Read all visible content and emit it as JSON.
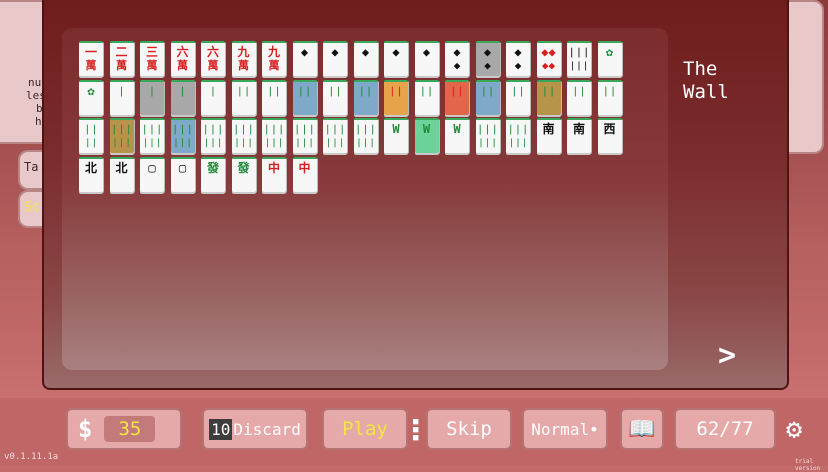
{
  "side_panel": {
    "lines": [
      "nu",
      "les",
      "b",
      "h"
    ],
    "tab_label": "Ta",
    "score_label": "Sc"
  },
  "wall": {
    "title": "The\nWall",
    "tiles": [
      {
        "glyph": "一",
        "sub": "萬",
        "color": "red",
        "hl": ""
      },
      {
        "glyph": "二",
        "sub": "萬",
        "color": "red",
        "hl": ""
      },
      {
        "glyph": "三",
        "sub": "萬",
        "color": "red",
        "hl": ""
      },
      {
        "glyph": "六",
        "sub": "萬",
        "color": "red",
        "hl": ""
      },
      {
        "glyph": "六",
        "sub": "萬",
        "color": "red",
        "hl": ""
      },
      {
        "glyph": "九",
        "sub": "萬",
        "color": "red",
        "hl": ""
      },
      {
        "glyph": "九",
        "sub": "萬",
        "color": "red",
        "hl": ""
      },
      {
        "glyph": "◆",
        "sub": "",
        "color": "black",
        "hl": ""
      },
      {
        "glyph": "◆",
        "sub": "",
        "color": "black",
        "hl": ""
      },
      {
        "glyph": "◆",
        "sub": "",
        "color": "black",
        "hl": ""
      },
      {
        "glyph": "◆",
        "sub": "",
        "color": "black",
        "hl": ""
      },
      {
        "glyph": "◆",
        "sub": "",
        "color": "black",
        "hl": ""
      },
      {
        "glyph": "◆",
        "sub": "◆",
        "color": "black",
        "hl": ""
      },
      {
        "glyph": "◆",
        "sub": "◆",
        "color": "black",
        "hl": "grey"
      },
      {
        "glyph": "◆",
        "sub": "◆",
        "color": "black",
        "hl": ""
      },
      {
        "glyph": "◆◆",
        "sub": "◆◆",
        "color": "red",
        "hl": ""
      },
      {
        "glyph": "❘❘❘",
        "sub": "❘❘❘",
        "color": "black",
        "hl": ""
      },
      {
        "glyph": "✿",
        "sub": "",
        "color": "green",
        "hl": ""
      },
      {
        "glyph": "✿",
        "sub": "",
        "color": "green",
        "hl": ""
      },
      {
        "glyph": "❘",
        "sub": "",
        "color": "green",
        "hl": ""
      },
      {
        "glyph": "❘",
        "sub": "",
        "color": "green",
        "hl": "grey"
      },
      {
        "glyph": "❘",
        "sub": "",
        "color": "green",
        "hl": "grey"
      },
      {
        "glyph": "❘",
        "sub": "",
        "color": "green",
        "hl": ""
      },
      {
        "glyph": "❘❘",
        "sub": "",
        "color": "green",
        "hl": ""
      },
      {
        "glyph": "❘❘",
        "sub": "",
        "color": "green",
        "hl": ""
      },
      {
        "glyph": "❘❘",
        "sub": "",
        "color": "green",
        "hl": "blue"
      },
      {
        "glyph": "❘❘",
        "sub": "",
        "color": "green",
        "hl": ""
      },
      {
        "glyph": "❘❘",
        "sub": "",
        "color": "green",
        "hl": "blue"
      },
      {
        "glyph": "❘❘",
        "sub": "",
        "color": "red",
        "hl": "orange"
      },
      {
        "glyph": "❘❘",
        "sub": "",
        "color": "green",
        "hl": ""
      },
      {
        "glyph": "❘❘",
        "sub": "",
        "color": "red",
        "hl": "red"
      },
      {
        "glyph": "❘❘",
        "sub": "",
        "color": "green",
        "hl": "blue"
      },
      {
        "glyph": "❘❘",
        "sub": "",
        "color": "green",
        "hl": ""
      },
      {
        "glyph": "❘❘",
        "sub": "",
        "color": "green",
        "hl": "olive"
      },
      {
        "glyph": "❘❘",
        "sub": "",
        "color": "green",
        "hl": ""
      },
      {
        "glyph": "❘❘",
        "sub": "",
        "color": "green",
        "hl": ""
      },
      {
        "glyph": "❘❘",
        "sub": "❘❘",
        "color": "green",
        "hl": ""
      },
      {
        "glyph": "❘❘❘",
        "sub": "❘❘❘",
        "color": "green",
        "hl": "olive"
      },
      {
        "glyph": "❘❘❘",
        "sub": "❘❘❘",
        "color": "green",
        "hl": ""
      },
      {
        "glyph": "❘❘❘",
        "sub": "❘❘❘",
        "color": "green",
        "hl": "blue"
      },
      {
        "glyph": "❘❘❘",
        "sub": "❘❘❘",
        "color": "green",
        "hl": ""
      },
      {
        "glyph": "❘❘❘",
        "sub": "❘❘❘",
        "color": "green",
        "hl": ""
      },
      {
        "glyph": "❘❘❘",
        "sub": "❘❘❘",
        "color": "green",
        "hl": ""
      },
      {
        "glyph": "❘❘❘",
        "sub": "❘❘❘",
        "color": "green",
        "hl": ""
      },
      {
        "glyph": "❘❘❘",
        "sub": "❘❘❘",
        "color": "green",
        "hl": ""
      },
      {
        "glyph": "❘❘❘",
        "sub": "❘❘❘",
        "color": "green",
        "hl": ""
      },
      {
        "glyph": "W",
        "sub": "",
        "color": "green",
        "hl": ""
      },
      {
        "glyph": "W",
        "sub": "",
        "color": "green",
        "hl": "green"
      },
      {
        "glyph": "W",
        "sub": "",
        "color": "green",
        "hl": ""
      },
      {
        "glyph": "❘❘❘",
        "sub": "❘❘❘",
        "color": "green",
        "hl": ""
      },
      {
        "glyph": "❘❘❘",
        "sub": "❘❘❘",
        "color": "green",
        "hl": ""
      },
      {
        "glyph": "南",
        "sub": "",
        "color": "black",
        "hl": ""
      },
      {
        "glyph": "南",
        "sub": "",
        "color": "black",
        "hl": ""
      },
      {
        "glyph": "西",
        "sub": "",
        "color": "black",
        "hl": ""
      },
      {
        "glyph": "北",
        "sub": "",
        "color": "black",
        "hl": ""
      },
      {
        "glyph": "北",
        "sub": "",
        "color": "black",
        "hl": ""
      },
      {
        "glyph": "▢",
        "sub": "",
        "color": "black",
        "hl": ""
      },
      {
        "glyph": "▢",
        "sub": "",
        "color": "black",
        "hl": ""
      },
      {
        "glyph": "發",
        "sub": "",
        "color": "green",
        "hl": ""
      },
      {
        "glyph": "發",
        "sub": "",
        "color": "green",
        "hl": ""
      },
      {
        "glyph": "中",
        "sub": "",
        "color": "red",
        "hl": ""
      },
      {
        "glyph": "中",
        "sub": "",
        "color": "red",
        "hl": ""
      }
    ],
    "next_label": ">"
  },
  "toolbar": {
    "money_symbol": "$",
    "money_value": "35",
    "discard_count": "10",
    "discard_label": "Discard",
    "play_label": "Play",
    "more_dots": "⋮",
    "skip_label": "Skip",
    "mode_label": "Normal•",
    "book_icon": "📖",
    "tile_count": "62/77",
    "gear_icon": "⚙"
  },
  "footer": {
    "version": "v0.1.11.1a",
    "trial": "trial version"
  },
  "colors": {
    "background": "#c46a6a",
    "modal": "#7a2c2c",
    "accent_yellow": "#f6e640",
    "tile_green_top": "#39a85a"
  }
}
